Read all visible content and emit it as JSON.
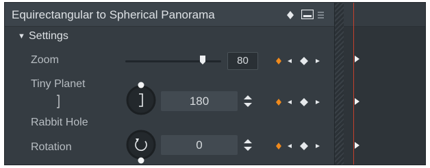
{
  "panel": {
    "title": "Equirectangular to Spherical Panorama",
    "section_label": "Settings"
  },
  "params": {
    "zoom": {
      "label": "Zoom",
      "value": "80",
      "slider_fraction": 0.8
    },
    "tiny_planet": {
      "label": "Tiny Planet",
      "value": "180"
    },
    "rabbit_hole": {
      "label": "Rabbit Hole"
    },
    "rotation": {
      "label": "Rotation",
      "value": "0"
    }
  },
  "colors": {
    "panel_bg": "#353c42",
    "title_bg": "#3c444b",
    "keyframe_active": "#f08a1c",
    "playhead": "#c6402c",
    "text": "#c9ced3"
  },
  "icons": [
    "diamond-icon",
    "monitor-icon",
    "menu-icon",
    "caret-down-icon",
    "slider-handle-icon",
    "spinner-arrows-icon",
    "keyframe-diamond-icon",
    "prev-keyframe-icon",
    "next-keyframe-icon",
    "tiny-planet-icon",
    "rotate-icon",
    "playhead-marker-icon"
  ]
}
